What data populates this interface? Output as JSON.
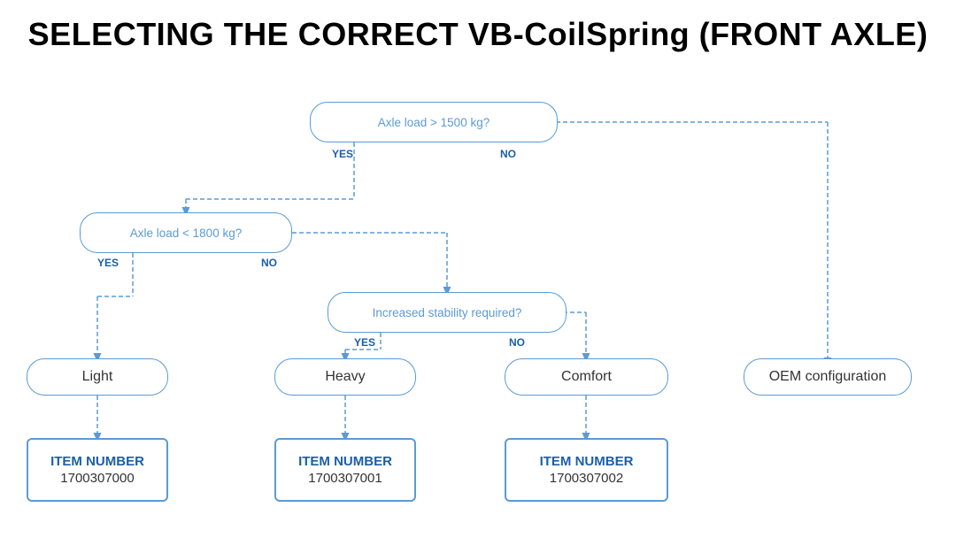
{
  "title": {
    "line1": "SELECTING THE CORRECT VB-CoilSpring (FRONT AXLE)"
  },
  "decisions": [
    {
      "id": "d1",
      "text": "Axle load > 1500 kg?",
      "yes_label": "YES",
      "no_label": "NO"
    },
    {
      "id": "d2",
      "text": "Axle load < 1800 kg?",
      "yes_label": "YES",
      "no_label": "NO"
    },
    {
      "id": "d3",
      "text": "Increased stability required?",
      "yes_label": "YES",
      "no_label": "NO"
    }
  ],
  "results": [
    {
      "id": "r1",
      "label": "Light"
    },
    {
      "id": "r2",
      "label": "Heavy"
    },
    {
      "id": "r3",
      "label": "Comfort"
    },
    {
      "id": "r4",
      "label": "OEM configuration"
    }
  ],
  "items": [
    {
      "id": "i1",
      "item_label": "ITEM NUMBER",
      "item_number": "1700307000"
    },
    {
      "id": "i2",
      "item_label": "ITEM NUMBER",
      "item_number": "1700307001"
    },
    {
      "id": "i3",
      "item_label": "ITEM NUMBER",
      "item_number": "1700307002"
    }
  ],
  "colors": {
    "blue": "#5b9bd5",
    "dark_blue": "#1a5fa8",
    "text": "#333"
  }
}
